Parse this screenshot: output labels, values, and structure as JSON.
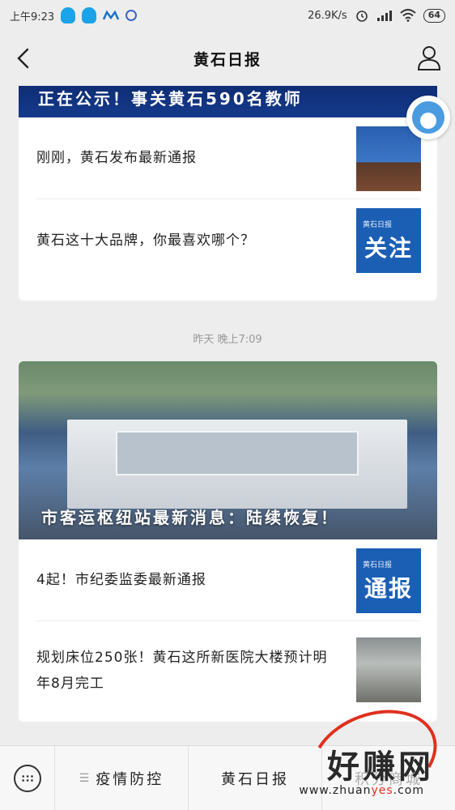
{
  "status_bar": {
    "time": "上午9:23",
    "speed": "26.9K/s",
    "battery": "64"
  },
  "nav": {
    "title": "黄石日报"
  },
  "card1": {
    "banner": "正在公示！事关黄石590名教师",
    "items": [
      {
        "title": "刚刚，黄石发布最新通报",
        "thumb": "conference-photo"
      },
      {
        "title": "黄石这十大品牌，你最喜欢哪个？",
        "thumb_small": "黄石日报",
        "thumb_big": "关注"
      }
    ]
  },
  "timestamp": "昨天 晚上7:09",
  "card2": {
    "hero_caption": "市客运枢纽站最新消息：陆续恢复！",
    "items": [
      {
        "title": "4起！市纪委监委最新通报",
        "thumb_small": "黄石日报",
        "thumb_big": "通报"
      },
      {
        "title": "规划床位250张！黄石这所新医院大楼预计明年8月完工",
        "thumb": "hospital-construction-photo"
      }
    ]
  },
  "bottom_menu": {
    "items": [
      {
        "label": "疫情防控",
        "icon": "menu-lines-icon"
      },
      {
        "label": "黄石日报",
        "icon": ""
      },
      {
        "label": "积分商城",
        "icon": ""
      }
    ]
  },
  "watermark": {
    "text": "好赚网",
    "url_prefix": "www.zhuan",
    "url_accent": "yes",
    "url_suffix": ".com"
  },
  "colors": {
    "background": "#ededed",
    "banner_blue": "#153a8c",
    "thumb_blue": "#1b5fb5",
    "watermark_red": "#e0301e"
  }
}
